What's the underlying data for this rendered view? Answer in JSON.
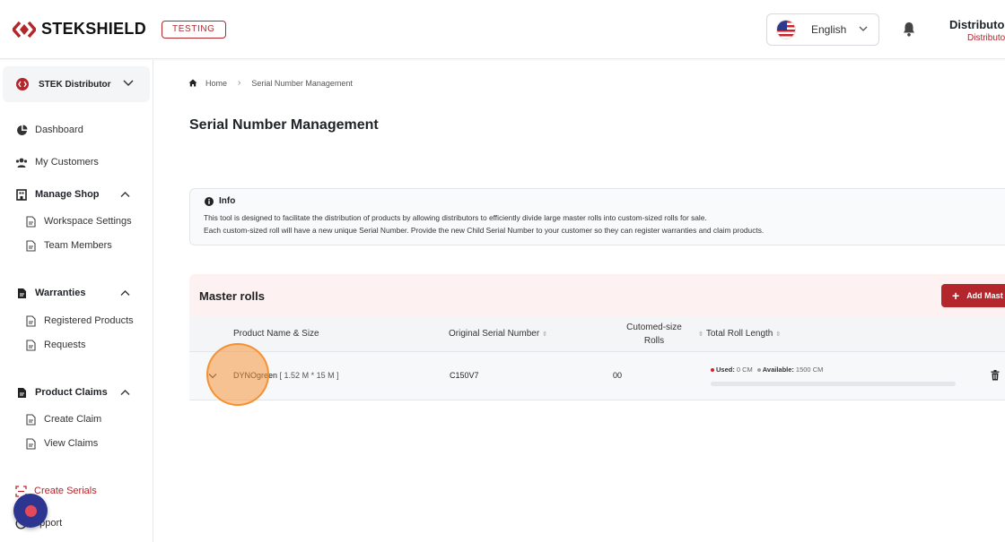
{
  "header": {
    "logo_text": "STEKSHIELD",
    "env_badge": "TESTING",
    "language": "English",
    "user_name": "Distributor",
    "user_role": "Distributor"
  },
  "sidebar": {
    "org": "STEK Distributor",
    "items": [
      {
        "label": "Dashboard",
        "icon": "pie-chart-icon"
      },
      {
        "label": "My Customers",
        "icon": "users-icon"
      },
      {
        "label": "Manage Shop",
        "icon": "building-icon"
      },
      {
        "label": "Workspace Settings",
        "icon": "document-icon"
      },
      {
        "label": "Team Members",
        "icon": "document-icon"
      },
      {
        "label": "Warranties",
        "icon": "file-icon"
      },
      {
        "label": "Registered Products",
        "icon": "document-icon"
      },
      {
        "label": "Requests",
        "icon": "document-icon"
      },
      {
        "label": "Product Claims",
        "icon": "file-icon"
      },
      {
        "label": "Create Claim",
        "icon": "document-icon"
      },
      {
        "label": "View Claims",
        "icon": "document-icon"
      },
      {
        "label": "Create Serials",
        "icon": "scan-icon"
      },
      {
        "label": "upport",
        "icon": "support-icon"
      }
    ]
  },
  "breadcrumb": {
    "home": "Home",
    "current": "Serial Number Management"
  },
  "page_title": "Serial Number Management",
  "info": {
    "title": "Info",
    "line1": "This tool is designed to facilitate the distribution of products by allowing distributors to efficiently divide large master rolls into custom-sized rolls for sale.",
    "line2": "Each custom-sized roll will have a new unique Serial Number. Provide the new Child Serial Number to your customer so they can register warranties and claim products."
  },
  "master_rolls": {
    "title": "Master rolls",
    "add_button": "Add Mast",
    "columns": {
      "product": "Product Name & Size",
      "serial": "Original Serial Number",
      "custom_line1": "Cutomed-size",
      "custom_line2": "Rolls",
      "length": "Total Roll Length"
    },
    "rows": [
      {
        "product": "DYNOgreen",
        "size": "[ 1.52 M * 15 M ]",
        "serial": "C150V7",
        "custom_rolls": "00",
        "used_label": "Used:",
        "used_value": "0 CM",
        "available_label": "Available:",
        "available_value": "1500 CM",
        "used_fraction": 0
      }
    ]
  },
  "colors": {
    "accent": "#b3262b",
    "used_dot": "#d0202a",
    "available_dot": "#9aa0a6"
  }
}
